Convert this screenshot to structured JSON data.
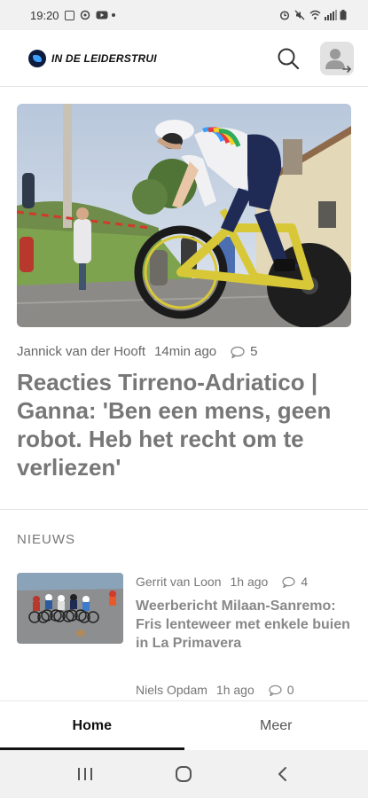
{
  "status_bar": {
    "time": "19:20"
  },
  "header": {
    "logo_text": "IN DE LEIDERSTRUI",
    "search_icon": "search-icon",
    "avatar_icon": "user-avatar-icon"
  },
  "hero": {
    "author": "Jannick van der Hooft",
    "time": "14min ago",
    "comments": "5",
    "title": "Reacties Tirreno-Adriatico | Ganna: 'Ben een mens, geen robot. Heb het recht om te verliezen'"
  },
  "section": {
    "label": "NIEUWS"
  },
  "news": [
    {
      "author": "Gerrit van Loon",
      "time": "1h ago",
      "comments": "4",
      "title": "Weerbericht Milaan-Sanremo: Fris lenteweer met enkele buien in La Primavera"
    },
    {
      "author": "Niels Opdam",
      "time": "1h ago",
      "comments": "0",
      "title": ""
    }
  ],
  "tabs": {
    "home": "Home",
    "more": "Meer"
  },
  "colors": {
    "accent_dark": "#111111",
    "muted_text": "#777777"
  }
}
